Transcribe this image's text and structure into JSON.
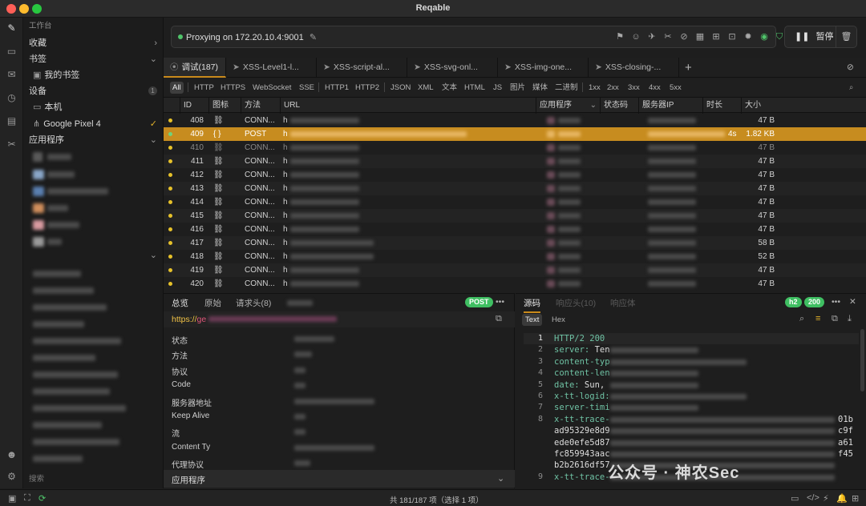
{
  "window": {
    "title": "Reqable",
    "traffic_colors": [
      "#fe5f57",
      "#febc2e",
      "#28c840"
    ]
  },
  "sidebar": {
    "header": "工作台",
    "sections": [
      {
        "label": "收藏"
      },
      {
        "label": "书签"
      },
      {
        "label": "我的书签"
      },
      {
        "label": "设备",
        "count": "1"
      },
      {
        "label": "本机"
      },
      {
        "label": "Google Pixel 4",
        "check": "✓"
      },
      {
        "label": "应用程序"
      }
    ],
    "search_placeholder": "搜索"
  },
  "proxy": {
    "status": "Proxying on 172.20.10.4:9001",
    "pause_label": "暂停"
  },
  "tabs": [
    {
      "label": "调试(187)"
    },
    {
      "label": "XSS-Level1-l..."
    },
    {
      "label": "XSS-script-al..."
    },
    {
      "label": "XSS-svg-onl..."
    },
    {
      "label": "XSS-img-one..."
    },
    {
      "label": "XSS-closing-..."
    }
  ],
  "filters": [
    "All",
    "HTTP",
    "HTTPS",
    "WebSocket",
    "SSE",
    "HTTP1",
    "HTTP2",
    "JSON",
    "XML",
    "文本",
    "HTML",
    "JS",
    "图片",
    "媒体",
    "二进制",
    "1xx",
    "2xx",
    "3xx",
    "4xx",
    "5xx"
  ],
  "table": {
    "columns": [
      "ID",
      "图标",
      "方法",
      "URL",
      "应用程序",
      "状态码",
      "服务器IP",
      "时长",
      "大小"
    ],
    "rows": [
      {
        "id": "408",
        "icon": "⛓",
        "method": "CONN...",
        "url": "h",
        "time": "",
        "size": "47 B"
      },
      {
        "id": "409",
        "icon": "{ }",
        "method": "POST",
        "url": "h",
        "time": "4s",
        "size": "1.82 KB",
        "selected": true
      },
      {
        "id": "410",
        "icon": "⛓",
        "method": "CONN...",
        "url": "h",
        "time": "",
        "size": "47 B",
        "dim": true
      },
      {
        "id": "411",
        "icon": "⛓",
        "method": "CONN...",
        "url": "h",
        "time": "",
        "size": "47 B"
      },
      {
        "id": "412",
        "icon": "⛓",
        "method": "CONN...",
        "url": "h",
        "time": "",
        "size": "47 B"
      },
      {
        "id": "413",
        "icon": "⛓",
        "method": "CONN...",
        "url": "h",
        "time": "",
        "size": "47 B"
      },
      {
        "id": "414",
        "icon": "⛓",
        "method": "CONN...",
        "url": "h",
        "time": "",
        "size": "47 B"
      },
      {
        "id": "415",
        "icon": "⛓",
        "method": "CONN...",
        "url": "h",
        "time": "",
        "size": "47 B"
      },
      {
        "id": "416",
        "icon": "⛓",
        "method": "CONN...",
        "url": "h",
        "time": "",
        "size": "47 B"
      },
      {
        "id": "417",
        "icon": "⛓",
        "method": "CONN...",
        "url": "h",
        "time": "",
        "size": "58 B"
      },
      {
        "id": "418",
        "icon": "⛓",
        "method": "CONN...",
        "url": "h",
        "time": "",
        "size": "52 B"
      },
      {
        "id": "419",
        "icon": "⛓",
        "method": "CONN...",
        "url": "h",
        "time": "",
        "size": "47 B"
      },
      {
        "id": "420",
        "icon": "⛓",
        "method": "CONN...",
        "url": "h",
        "time": "",
        "size": "47 B"
      }
    ]
  },
  "overview": {
    "tabs": [
      "总览",
      "原始",
      "请求头(8)"
    ],
    "method_badge": "POST",
    "url_prefix": "https://",
    "url_fragment": "ge",
    "keys": [
      "状态",
      "方法",
      "协议",
      "Code",
      "服务器地址",
      "Keep Alive",
      "流",
      "Content Ty",
      "代理协议"
    ],
    "footer": "应用程序"
  },
  "response": {
    "tabs": [
      "源码",
      "响应头(10)",
      "响应体"
    ],
    "proto_badge": "h2",
    "status_badge": "200",
    "view_tabs": [
      "Text",
      "Hex"
    ],
    "lines": [
      {
        "n": "1",
        "key": "HTTP/2 200",
        "val": ""
      },
      {
        "n": "2",
        "key": "server:",
        "val": " Ten"
      },
      {
        "n": "3",
        "key": "content-typ",
        "val": ""
      },
      {
        "n": "4",
        "key": "content-len",
        "val": ""
      },
      {
        "n": "5",
        "key": "date:",
        "val": " Sun,"
      },
      {
        "n": "6",
        "key": "x-tt-logid:",
        "val": ""
      },
      {
        "n": "7",
        "key": "server-timi",
        "val": ""
      },
      {
        "n": "8",
        "key": "x-tt-trace-",
        "val": ""
      },
      {
        "n": "",
        "key": "",
        "val": "ad95329e8d9"
      },
      {
        "n": "",
        "key": "",
        "val": "ede0efe5d87"
      },
      {
        "n": "",
        "key": "",
        "val": "fc859943aac"
      },
      {
        "n": "",
        "key": "",
        "val": "b2b2616df57"
      },
      {
        "n": "9",
        "key": "x-tt-trace-",
        "val": ""
      }
    ],
    "line_tails": [
      "01b",
      "c9f",
      "a61",
      "f45"
    ]
  },
  "status": {
    "summary": "共 181/187 项（选择 1 项）"
  },
  "watermark": "公众号 · 神农Sec"
}
